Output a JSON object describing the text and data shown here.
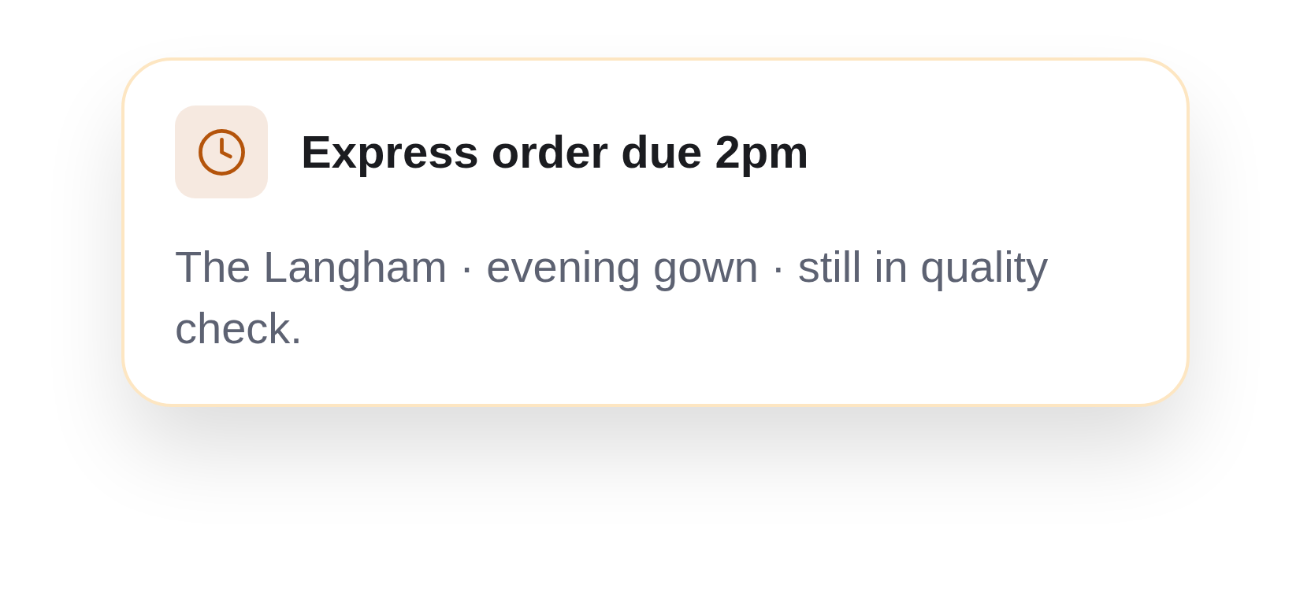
{
  "notification": {
    "title": "Express order due 2pm",
    "message": "The Langham · evening gown · still in quality check."
  }
}
